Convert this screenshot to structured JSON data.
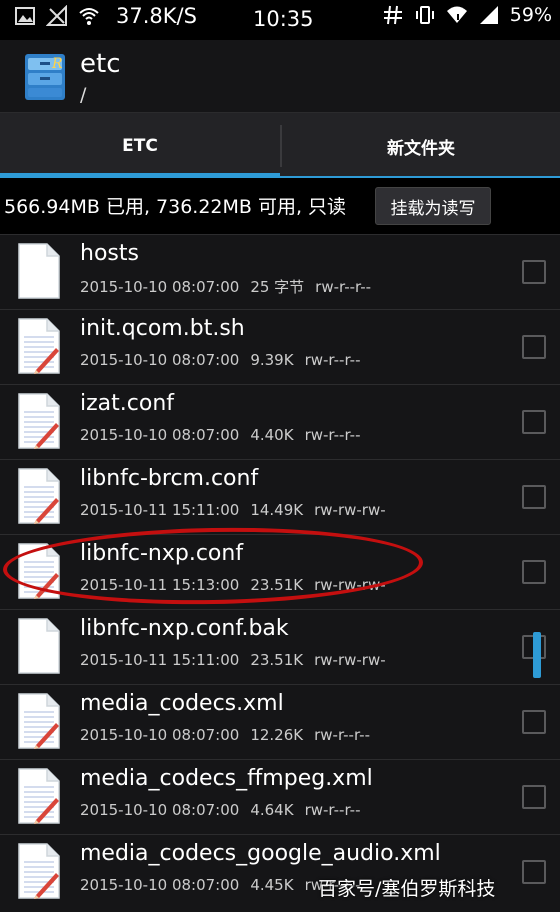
{
  "statusbar": {
    "speed": "37.8K/S",
    "time": "10:35",
    "battery": "59%"
  },
  "actionbar": {
    "title": "etc",
    "path": "/"
  },
  "tabs": [
    {
      "label": "ETC",
      "active": true
    },
    {
      "label": "新文件夹",
      "active": false
    }
  ],
  "storage": {
    "info": "566.94MB 已用, 736.22MB 可用, 只读",
    "mount_button": "挂载为读写"
  },
  "files": [
    {
      "name": "hosts",
      "date": "2015-10-10 08:07:00",
      "size": "25 字节",
      "perms": "rw-r--r--",
      "icon": "blank-file-icon"
    },
    {
      "name": "init.qcom.bt.sh",
      "date": "2015-10-10 08:07:00",
      "size": "9.39K",
      "perms": "rw-r--r--",
      "icon": "text-file-icon"
    },
    {
      "name": "izat.conf",
      "date": "2015-10-10 08:07:00",
      "size": "4.40K",
      "perms": "rw-r--r--",
      "icon": "text-file-icon"
    },
    {
      "name": "libnfc-brcm.conf",
      "date": "2015-10-11 15:11:00",
      "size": "14.49K",
      "perms": "rw-rw-rw-",
      "icon": "text-file-icon"
    },
    {
      "name": "libnfc-nxp.conf",
      "date": "2015-10-11 15:13:00",
      "size": "23.51K",
      "perms": "rw-rw-rw-",
      "icon": "text-file-icon"
    },
    {
      "name": "libnfc-nxp.conf.bak",
      "date": "2015-10-11 15:11:00",
      "size": "23.51K",
      "perms": "rw-rw-rw-",
      "icon": "blank-file-icon"
    },
    {
      "name": "media_codecs.xml",
      "date": "2015-10-10 08:07:00",
      "size": "12.26K",
      "perms": "rw-r--r--",
      "icon": "text-file-icon"
    },
    {
      "name": "media_codecs_ffmpeg.xml",
      "date": "2015-10-10 08:07:00",
      "size": "4.64K",
      "perms": "rw-r--r--",
      "icon": "text-file-icon"
    },
    {
      "name": "media_codecs_google_audio.xml",
      "date": "2015-10-10 08:07:00",
      "size": "4.45K",
      "perms": "rw-r--r--",
      "icon": "text-file-icon"
    }
  ],
  "watermark": "百家号/塞伯罗斯科技",
  "colors": {
    "accent": "#2e9bd6",
    "highlight": "#c40f0f",
    "background": "#151517"
  }
}
